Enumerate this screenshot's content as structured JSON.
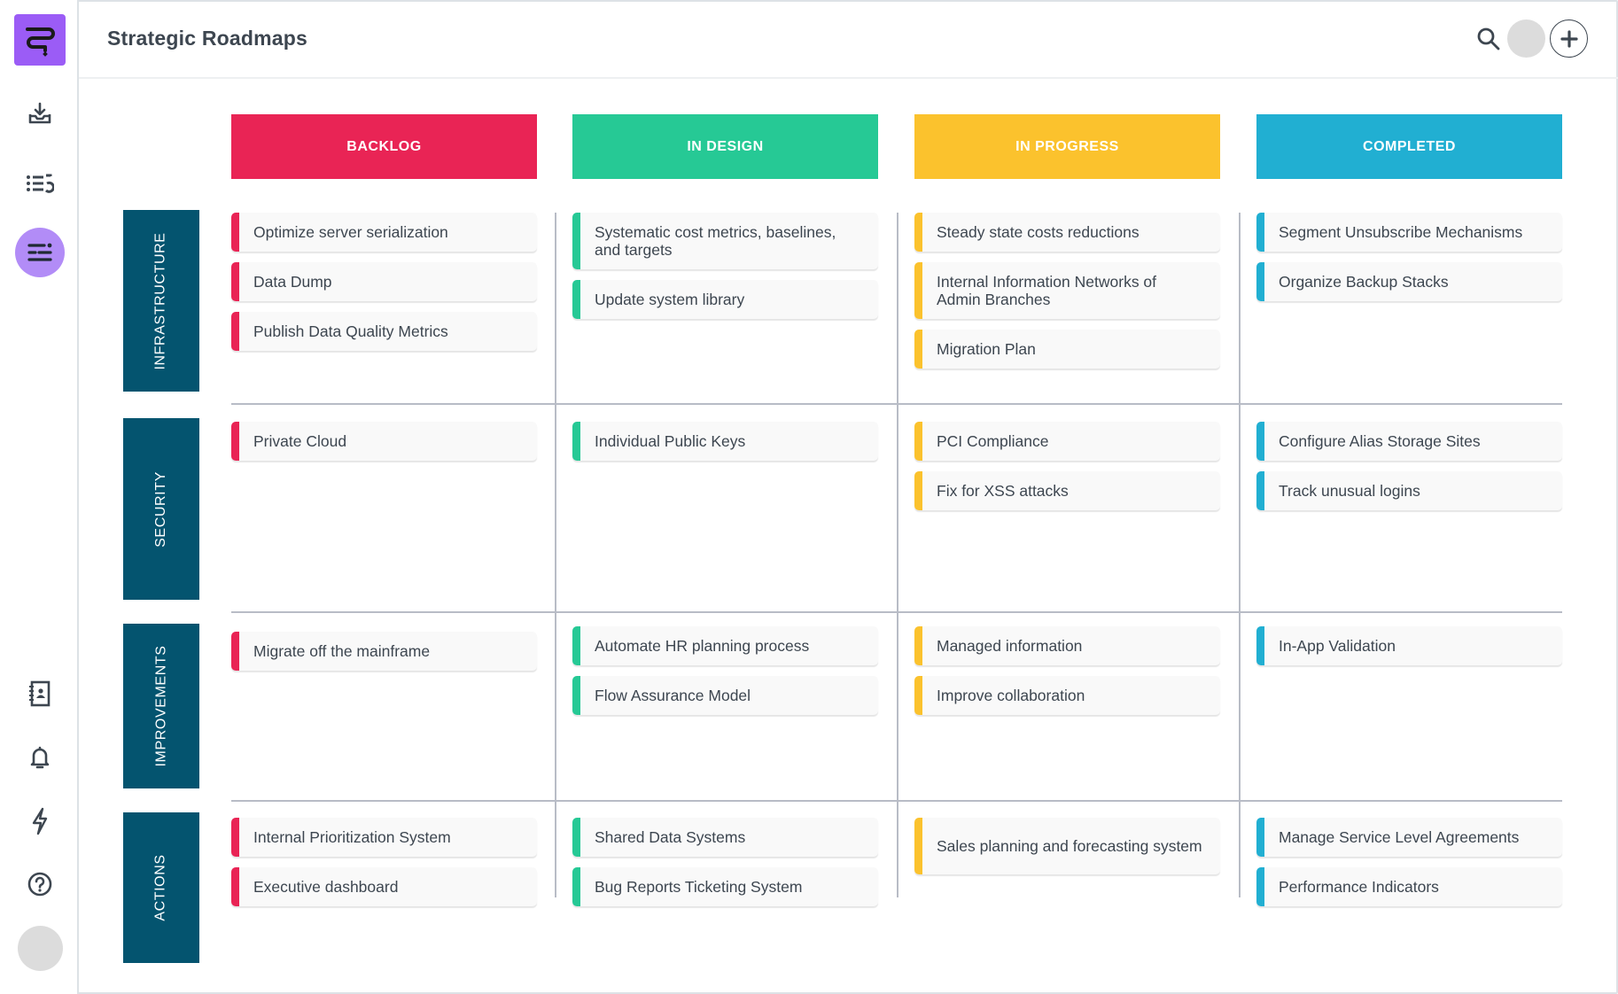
{
  "app": {
    "title": "Strategic Roadmaps",
    "logo_icon": "roadmap-logo-icon"
  },
  "sidebar": {
    "top_items": [
      {
        "name": "import",
        "icon": "download-tray-icon"
      },
      {
        "name": "backlog-list",
        "icon": "list-undo-icon"
      },
      {
        "name": "roadmaps",
        "icon": "roadmap-lines-icon",
        "active": true
      }
    ],
    "bottom_items": [
      {
        "name": "contacts",
        "icon": "address-book-icon"
      },
      {
        "name": "notifications",
        "icon": "bell-icon"
      },
      {
        "name": "activity",
        "icon": "lightning-icon"
      },
      {
        "name": "help",
        "icon": "question-circle-icon"
      }
    ],
    "active_color": "#b28cf7"
  },
  "header": {
    "search_icon": "search-icon",
    "add_icon": "plus-icon"
  },
  "columns": [
    {
      "label": "BACKLOG",
      "color": "#e92455"
    },
    {
      "label": "IN DESIGN",
      "color": "#26c995"
    },
    {
      "label": "IN PROGRESS",
      "color": "#fbc22d"
    },
    {
      "label": "COMPLETED",
      "color": "#21afd2"
    }
  ],
  "rows": [
    {
      "label": "INFRASTRUCTURE",
      "cells": [
        [
          "Optimize server serialization",
          "Data Dump",
          "Publish Data Quality Metrics"
        ],
        [
          "Systematic cost metrics, baselines, and targets",
          "Update system library"
        ],
        [
          "Steady state costs reductions",
          "Internal Information Networks of Admin Branches",
          "Migration Plan"
        ],
        [
          "Segment Unsubscribe Mechanisms",
          "Organize Backup Stacks"
        ]
      ]
    },
    {
      "label": "SECURITY",
      "cells": [
        [
          "Private Cloud"
        ],
        [
          "Individual Public Keys"
        ],
        [
          "PCI Compliance",
          "Fix for XSS attacks"
        ],
        [
          "Configure Alias Storage Sites",
          "Track unusual logins"
        ]
      ]
    },
    {
      "label": "IMPROVEMENTS",
      "cells": [
        [
          "Migrate off the mainframe"
        ],
        [
          "Automate HR planning process",
          "Flow Assurance Model"
        ],
        [
          "Managed information",
          "Improve collaboration"
        ],
        [
          "In-App Validation"
        ]
      ]
    },
    {
      "label": "ACTIONS",
      "cells": [
        [
          "Internal Prioritization System",
          "Executive dashboard"
        ],
        [
          "Shared Data Systems",
          "Bug Reports Ticketing System"
        ],
        [
          "Sales planning and forecasting system"
        ],
        [
          "Manage Service Level Agreements",
          "Performance Indicators"
        ]
      ]
    }
  ]
}
